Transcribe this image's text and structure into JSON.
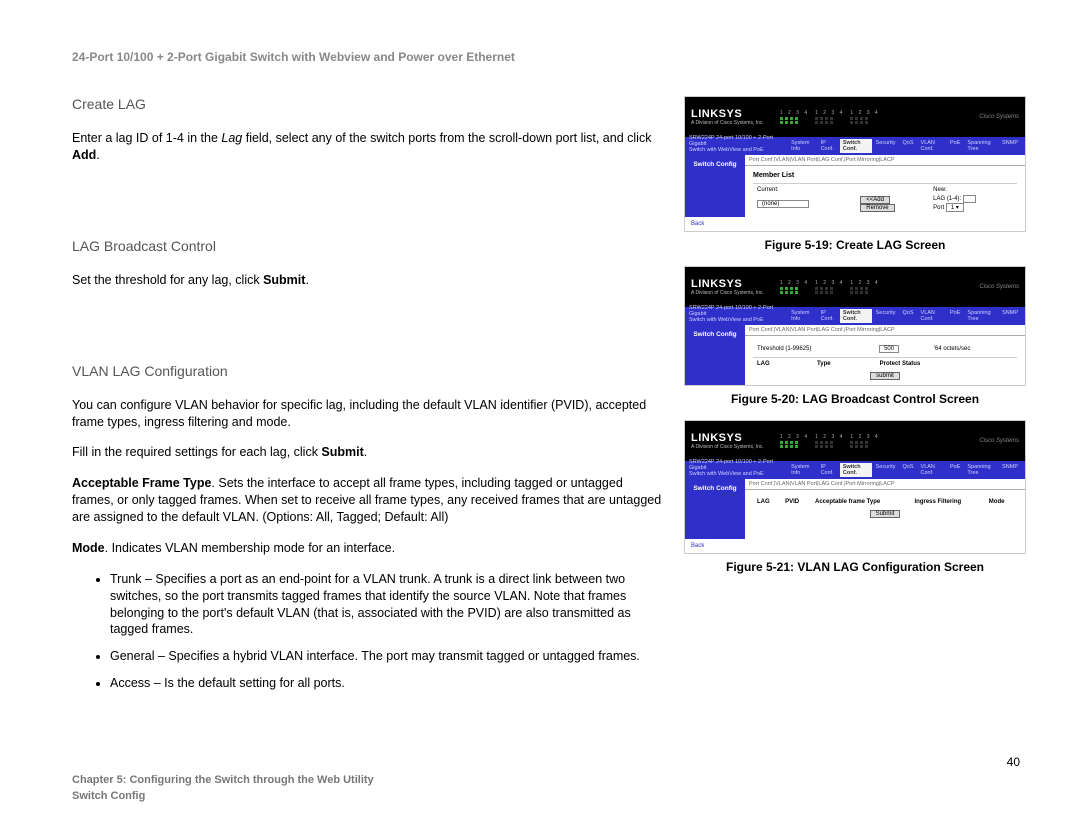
{
  "doc_title": "24-Port 10/100 + 2-Port Gigabit Switch with Webview and Power over Ethernet",
  "sections": {
    "create_lag": {
      "heading": "Create LAG",
      "p1_a": "Enter a lag ID of 1-4 in the ",
      "p1_b": "Lag",
      "p1_c": " field, select any of the switch ports from the scroll-down port list, and click ",
      "p1_d": "Add",
      "p1_e": "."
    },
    "broadcast": {
      "heading": "LAG Broadcast Control",
      "p1_a": "Set the threshold for any lag, click ",
      "p1_b": "Submit",
      "p1_c": "."
    },
    "vlan": {
      "heading": "VLAN LAG Configuration",
      "p1": "You can configure VLAN behavior for specific lag, including the default VLAN identifier (PVID), accepted frame types, ingress filtering and mode.",
      "p2_a": "Fill in the required settings for each lag, click ",
      "p2_b": "Submit",
      "p2_c": ".",
      "p3_a": "Acceptable Frame Type",
      "p3_b": ". Sets the interface to accept all frame types, including tagged or untagged frames, or only tagged frames. When set to receive all frame types, any received frames that are untagged are assigned to the default VLAN. (Options: All, Tagged; Default: All)",
      "p4_a": "Mode",
      "p4_b": ". Indicates VLAN membership mode for an interface.",
      "bullets": {
        "b1": "Trunk – Specifies a port as an end-point for a VLAN trunk. A trunk is a direct link between two switches, so the port transmits tagged frames that identify the source VLAN. Note that frames belonging to the port's default VLAN (that is, associated with the PVID) are also transmitted as tagged frames.",
        "b2": "General – Specifies a hybrid VLAN interface. The port may transmit tagged or untagged frames.",
        "b3": "Access – Is the default setting for all ports."
      }
    }
  },
  "figures": {
    "f19": "Figure 5-19: Create LAG Screen",
    "f20": "Figure 5-20: LAG Broadcast Control Screen",
    "f21": "Figure 5-21: VLAN LAG Configuration Screen"
  },
  "shot": {
    "logo": "LINKSYS",
    "logo_sub": "A Division of Cisco Systems, Inc.",
    "cisco": "Cisco Systems",
    "master_a": "SRW224P 24-port 10/100 + 2-Port Gigabit",
    "master_b": "Switch with WebView and PoE",
    "main_tabs": {
      "t1": "System Info",
      "t2": "IP Conf.",
      "t3": "Switch Conf.",
      "t4": "Security",
      "t5": "QoS",
      "t6": "VLAN Conf.",
      "t7": "PoE",
      "t8": "Spanning Tree",
      "t9": "SNMP"
    },
    "side": "Switch Config",
    "subtabs": "Port Conf.|VLAN|VLAN Port|LAG Conf.|Port Mirroring|LACP",
    "back": "Back",
    "fig19": {
      "title": "Member List",
      "col1": "Current:",
      "col2": "New:",
      "sel": "(none)",
      "addbtn": "<<Add",
      "rembtn": "Remove",
      "laglabel": "LAG (1-4):",
      "portlabel": "Port"
    },
    "fig20": {
      "thresh": "Threshold (1-99625)",
      "thresh_val": "500",
      "thresh_unit": "'64 octets/sec",
      "h1": "LAG",
      "h2": "Type",
      "h3": "Protect Status",
      "submit": "submit"
    },
    "fig21": {
      "h1": "LAG",
      "h2": "PVID",
      "h3": "Acceptable frame Type",
      "h4": "Ingress Filtering",
      "h5": "Mode",
      "submit": "Submit"
    }
  },
  "page_number": "40",
  "footer": {
    "line1": "Chapter 5: Configuring the Switch through the Web Utility",
    "line2": "Switch Config"
  }
}
